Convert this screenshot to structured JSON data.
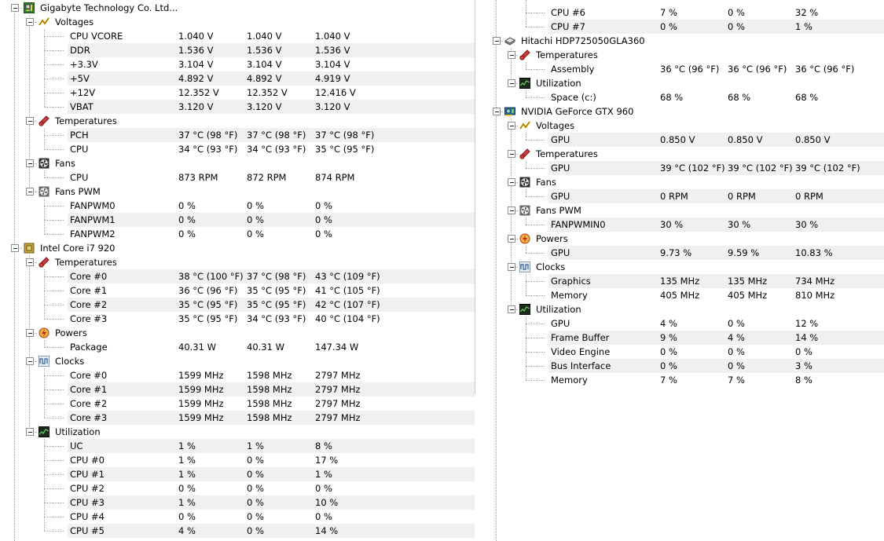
{
  "left_tree": [
    {
      "type": "device",
      "icon": "motherboard-icon",
      "label": "Gigabyte Technology Co. Ltd...",
      "groups": [
        {
          "icon": "voltage-icon",
          "label": "Voltages",
          "rows": [
            [
              "CPU VCORE",
              "1.040 V",
              "1.040 V",
              "1.040 V"
            ],
            [
              "DDR",
              "1.536 V",
              "1.536 V",
              "1.536 V"
            ],
            [
              "+3.3V",
              "3.104 V",
              "3.104 V",
              "3.104 V"
            ],
            [
              "+5V",
              "4.892 V",
              "4.892 V",
              "4.919 V"
            ],
            [
              "+12V",
              "12.352 V",
              "12.352 V",
              "12.416 V"
            ],
            [
              "VBAT",
              "3.120 V",
              "3.120 V",
              "3.120 V"
            ]
          ]
        },
        {
          "icon": "temperature-icon",
          "label": "Temperatures",
          "rows": [
            [
              "PCH",
              "37 °C  (98 °F)",
              "37 °C  (98 °F)",
              "37 °C  (98 °F)"
            ],
            [
              "CPU",
              "34 °C  (93 °F)",
              "34 °C  (93 °F)",
              "35 °C  (95 °F)"
            ]
          ]
        },
        {
          "icon": "fan-icon",
          "label": "Fans",
          "rows": [
            [
              "CPU",
              "873 RPM",
              "872 RPM",
              "874 RPM"
            ]
          ]
        },
        {
          "icon": "fan-pwm-icon",
          "label": "Fans PWM",
          "rows": [
            [
              "FANPWM0",
              "0 %",
              "0 %",
              "0 %"
            ],
            [
              "FANPWM1",
              "0 %",
              "0 %",
              "0 %"
            ],
            [
              "FANPWM2",
              "0 %",
              "0 %",
              "0 %"
            ]
          ]
        }
      ]
    },
    {
      "type": "device",
      "icon": "cpu-chip-icon",
      "label": "Intel Core i7 920",
      "groups": [
        {
          "icon": "temperature-icon",
          "label": "Temperatures",
          "rows": [
            [
              "Core #0",
              "38 °C  (100 °F)",
              "37 °C  (98 °F)",
              "43 °C  (109 °F)"
            ],
            [
              "Core #1",
              "36 °C  (96 °F)",
              "35 °C  (95 °F)",
              "41 °C  (105 °F)"
            ],
            [
              "Core #2",
              "35 °C  (95 °F)",
              "35 °C  (95 °F)",
              "42 °C  (107 °F)"
            ],
            [
              "Core #3",
              "35 °C  (95 °F)",
              "34 °C  (93 °F)",
              "40 °C  (104 °F)"
            ]
          ]
        },
        {
          "icon": "power-icon",
          "label": "Powers",
          "rows": [
            [
              "Package",
              "40.31 W",
              "40.31 W",
              "147.34 W"
            ]
          ]
        },
        {
          "icon": "clock-icon",
          "label": "Clocks",
          "rows": [
            [
              "Core #0",
              "1599 MHz",
              "1598 MHz",
              "2797 MHz"
            ],
            [
              "Core #1",
              "1599 MHz",
              "1598 MHz",
              "2797 MHz"
            ],
            [
              "Core #2",
              "1599 MHz",
              "1598 MHz",
              "2797 MHz"
            ],
            [
              "Core #3",
              "1599 MHz",
              "1598 MHz",
              "2797 MHz"
            ]
          ]
        },
        {
          "icon": "utilization-icon",
          "label": "Utilization",
          "rows": [
            [
              "UC",
              "1 %",
              "1 %",
              "8 %"
            ],
            [
              "CPU #0",
              "1 %",
              "0 %",
              "17 %"
            ],
            [
              "CPU #1",
              "1 %",
              "0 %",
              "1 %"
            ],
            [
              "CPU #2",
              "0 %",
              "0 %",
              "0 %"
            ],
            [
              "CPU #3",
              "1 %",
              "0 %",
              "10 %"
            ],
            [
              "CPU #4",
              "0 %",
              "0 %",
              "0 %"
            ],
            [
              "CPU #5",
              "4 %",
              "0 %",
              "14 %"
            ]
          ]
        }
      ]
    }
  ],
  "right_tree": [
    {
      "type": "continuation",
      "rows": [
        [
          "CPU #6",
          "7 %",
          "0 %",
          "32 %"
        ],
        [
          "CPU #7",
          "0 %",
          "0 %",
          "1 %"
        ]
      ]
    },
    {
      "type": "device",
      "icon": "hard-drive-icon",
      "label": "Hitachi HDP725050GLA360",
      "groups": [
        {
          "icon": "temperature-icon",
          "label": "Temperatures",
          "rows": [
            [
              "Assembly",
              "36 °C  (96 °F)",
              "36 °C  (96 °F)",
              "36 °C  (96 °F)"
            ]
          ]
        },
        {
          "icon": "utilization-icon",
          "label": "Utilization",
          "rows": [
            [
              "Space (c:)",
              "68 %",
              "68 %",
              "68 %"
            ]
          ]
        }
      ]
    },
    {
      "type": "device",
      "icon": "gpu-card-icon",
      "label": "NVIDIA GeForce GTX 960",
      "groups": [
        {
          "icon": "voltage-icon",
          "label": "Voltages",
          "rows": [
            [
              "GPU",
              "0.850 V",
              "0.850 V",
              "0.850 V"
            ]
          ]
        },
        {
          "icon": "temperature-icon",
          "label": "Temperatures",
          "rows": [
            [
              "GPU",
              "39 °C  (102 °F)",
              "39 °C  (102 °F)",
              "39 °C  (102 °F)"
            ]
          ]
        },
        {
          "icon": "fan-icon",
          "label": "Fans",
          "rows": [
            [
              "GPU",
              "0 RPM",
              "0 RPM",
              "0 RPM"
            ]
          ]
        },
        {
          "icon": "fan-pwm-icon",
          "label": "Fans PWM",
          "rows": [
            [
              "FANPWMIN0",
              "30 %",
              "30 %",
              "30 %"
            ]
          ]
        },
        {
          "icon": "power-icon",
          "label": "Powers",
          "rows": [
            [
              "GPU",
              "9.73 %",
              "9.59 %",
              "10.83 %"
            ]
          ]
        },
        {
          "icon": "clock-icon",
          "label": "Clocks",
          "rows": [
            [
              "Graphics",
              "135 MHz",
              "135 MHz",
              "734 MHz"
            ],
            [
              "Memory",
              "405 MHz",
              "405 MHz",
              "810 MHz"
            ]
          ]
        },
        {
          "icon": "utilization-icon",
          "label": "Utilization",
          "rows": [
            [
              "GPU",
              "4 %",
              "0 %",
              "12 %"
            ],
            [
              "Frame Buffer",
              "9 %",
              "4 %",
              "14 %"
            ],
            [
              "Video Engine",
              "0 %",
              "0 %",
              "0 %"
            ],
            [
              "Bus Interface",
              "0 %",
              "0 %",
              "3 %"
            ],
            [
              "Memory",
              "7 %",
              "7 %",
              "8 %"
            ]
          ]
        }
      ]
    }
  ]
}
